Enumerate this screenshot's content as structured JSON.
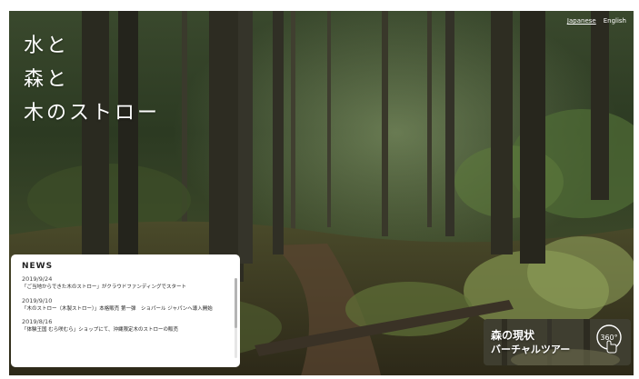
{
  "languages": {
    "japanese": "Japanese",
    "english": "English"
  },
  "hero": {
    "line1": "水と",
    "line2": "森と",
    "line3": "木のストロー"
  },
  "news": {
    "heading": "NEWS",
    "items": [
      {
        "date": "2019/9/24",
        "text": "「ご当地からできた木のストロー」がクラウドファンディングでスタート"
      },
      {
        "date": "2019/9/10",
        "text": "「木のストロー（木製ストロー）」本格販売 第一弾　ショパール ジャパンへ導入開始"
      },
      {
        "date": "2019/8/16",
        "text": "「体験王国 むら咲むら」ショップにて、沖縄限定木のストローの販売"
      }
    ]
  },
  "tour": {
    "line1": "森の現状",
    "line2": "バーチャルツアー",
    "icon_label": "360°",
    "icon": "360-hand-icon"
  }
}
